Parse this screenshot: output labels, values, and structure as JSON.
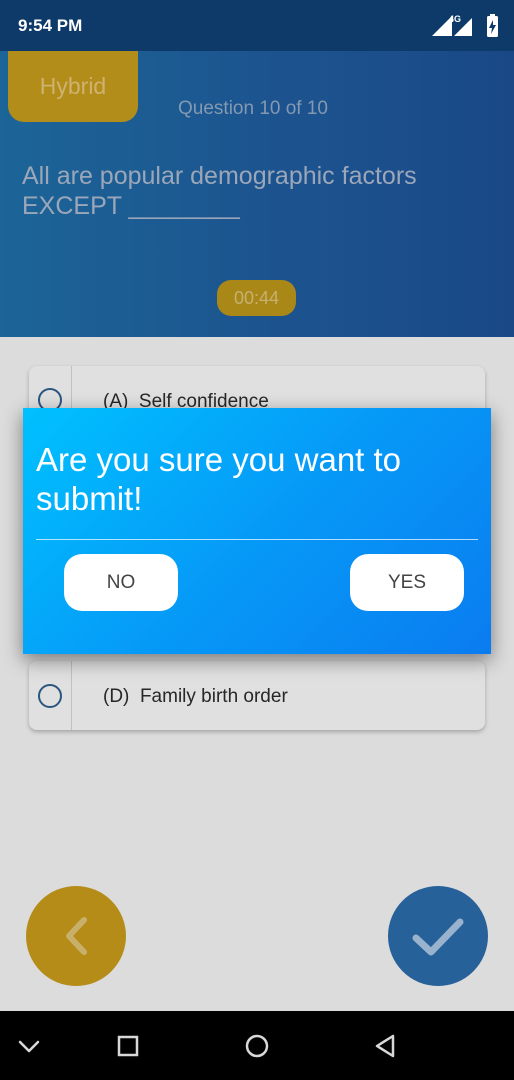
{
  "status_bar": {
    "time": "9:54 PM",
    "network": "4G"
  },
  "quiz": {
    "mode_badge": "Hybrid",
    "question_counter": "Question 10 of 10",
    "question_text": "All are popular demographic factors EXCEPT ________",
    "timer": "00:44"
  },
  "options": [
    {
      "label": "(A)",
      "text": "Self confidence"
    },
    {
      "label": "(D)",
      "text": "Family birth order"
    }
  ],
  "dialog": {
    "message": "Are you sure you want to submit!",
    "no_label": "NO",
    "yes_label": "YES"
  },
  "icons": {
    "prev": "chevron-left-icon",
    "submit": "checkmark-icon",
    "nav_down": "chevron-down-icon",
    "nav_recents": "square-icon",
    "nav_home": "circle-icon",
    "nav_back": "triangle-back-icon"
  },
  "colors": {
    "dialog_gradient_start": "#00c1ff",
    "dialog_gradient_end": "#0a7cf0",
    "accent_gold": "#c6981c",
    "accent_blue": "#2a6aa6"
  }
}
